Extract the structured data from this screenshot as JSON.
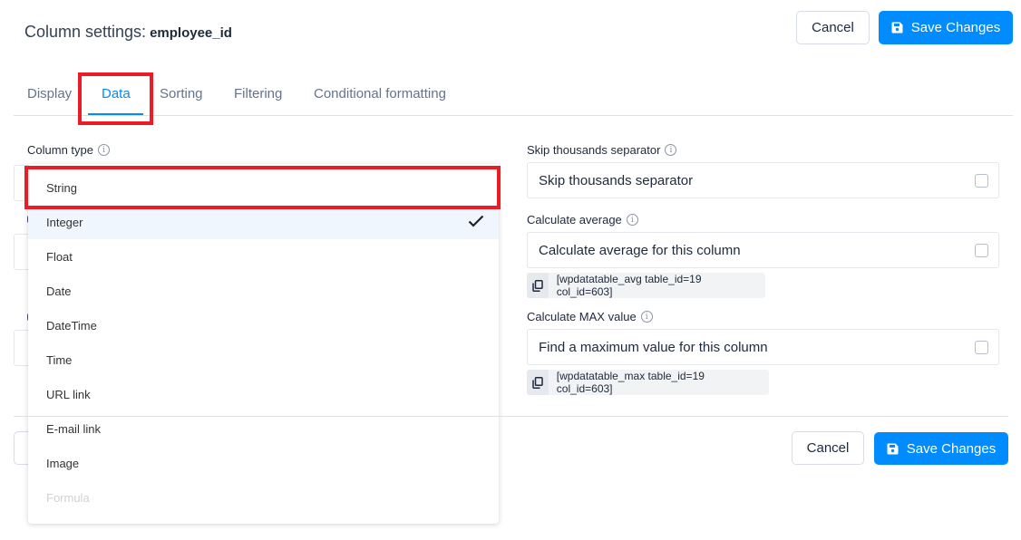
{
  "header": {
    "title_prefix": "Column settings:",
    "column_name": "employee_id",
    "cancel_label": "Cancel",
    "save_label": "Save Changes"
  },
  "tabs": [
    {
      "label": "Display",
      "active": false
    },
    {
      "label": "Data",
      "active": true
    },
    {
      "label": "Sorting",
      "active": false
    },
    {
      "label": "Filtering",
      "active": false
    },
    {
      "label": "Conditional formatting",
      "active": false
    }
  ],
  "left": {
    "column_type_label": "Column type",
    "column_type_value": "Integer",
    "column_type_options": [
      {
        "label": "String",
        "selected": false,
        "disabled": false,
        "highlighted": true
      },
      {
        "label": "Integer",
        "selected": true,
        "disabled": false
      },
      {
        "label": "Float",
        "selected": false,
        "disabled": false
      },
      {
        "label": "Date",
        "selected": false,
        "disabled": false
      },
      {
        "label": "DateTime",
        "selected": false,
        "disabled": false
      },
      {
        "label": "Time",
        "selected": false,
        "disabled": false
      },
      {
        "label": "URL link",
        "selected": false,
        "disabled": false
      },
      {
        "label": "E-mail link",
        "selected": false,
        "disabled": false
      },
      {
        "label": "Image",
        "selected": false,
        "disabled": false
      },
      {
        "label": "Formula",
        "selected": false,
        "disabled": true
      }
    ]
  },
  "right": {
    "skip_thousands": {
      "label": "Skip thousands separator",
      "checkbox_label": "Skip thousands separator",
      "checked": false
    },
    "calc_avg": {
      "label": "Calculate average",
      "checkbox_label": "Calculate average for this column",
      "checked": false,
      "shortcode": "[wpdatatable_avg table_id=19 col_id=603]"
    },
    "calc_max": {
      "label": "Calculate MAX value",
      "checkbox_label": "Find a maximum value for this column",
      "checked": false,
      "shortcode": "[wpdatatable_max table_id=19 col_id=603]"
    }
  },
  "footer": {
    "cancel_label": "Cancel",
    "save_label": "Save Changes"
  },
  "colors": {
    "accent": "#008cff",
    "highlight": "#ed1c24",
    "selected_row": "#eff6fe"
  }
}
